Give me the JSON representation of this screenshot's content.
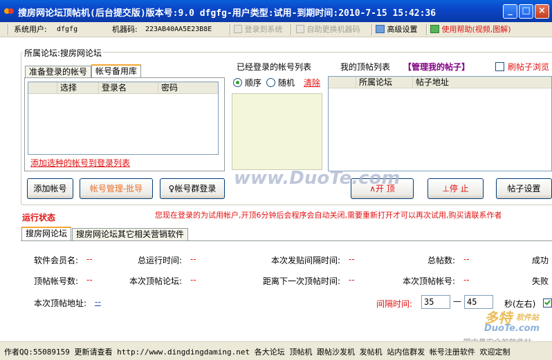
{
  "window": {
    "title": "搜房网论坛顶帖机(后台提交版)版本号:9.0 dfgfg-用户类型:试用-到期时间:2010-7-15 15:42:36",
    "minimize_glyph": "_",
    "maximize_glyph": "□",
    "close_glyph": "×"
  },
  "toolbar": {
    "system_user_label": "系统用户:",
    "system_user_value": "dfgfg",
    "machine_code_label": "机器码:",
    "machine_code_value": "223AB40AA5E23B8E",
    "login_button": "登录到系统",
    "change_machine_button": "自助更换机器码",
    "advanced_settings": "高级设置",
    "help": "使用帮助(视频,图解)"
  },
  "forum_group": {
    "title": "所属论坛:搜房网论坛",
    "tabs": [
      "准备登录的帐号",
      "帐号备用库"
    ],
    "active_tab": 1,
    "columns": [
      "选择",
      "登录名",
      "密码"
    ],
    "add_link": "添加选种的帐号到登录列表"
  },
  "logged_accounts": {
    "title": "已经登录的帐号列表",
    "radio_sequential": "顺序",
    "radio_random": "随机",
    "clear_link": "清除",
    "selected": "顺序"
  },
  "my_posts": {
    "title": "我的顶帖列表",
    "manage_link": "【管理我的帖子】",
    "browse_checkbox": "刷帖子浏览",
    "browse_checked": false,
    "columns": [
      "所属论坛",
      "帖子地址"
    ]
  },
  "buttons": {
    "add_account": "添加帐号",
    "account_manage": "帐号管理-批导",
    "group_login": "♀帐号群登录",
    "start": "∧开  顶",
    "stop": "⊥停  止",
    "post_settings": "帖子设置"
  },
  "notice": "您现在登录的为试用帐户,开顶6分钟后会程序会自动关闭,需要重新打开才可以再次试用,购买请联系作者",
  "run_status": {
    "title": "运行状态",
    "tabs": [
      "搜房网论坛",
      "搜房网论坛其它相关营销软件"
    ],
    "active_tab": 0,
    "stats": {
      "member_name_label": "软件会员名:",
      "member_name_value": "--",
      "total_run_time_label": "总运行时间:",
      "total_run_time_value": "--",
      "post_interval_label": "本次发贴间隔时间:",
      "post_interval_value": "--",
      "total_posts_label": "总帖数:",
      "total_posts_value": "--",
      "success_label": "成功",
      "account_count_label": "顶帖帐号数:",
      "account_count_value": "--",
      "current_forum_label": "本次顶帖论坛:",
      "current_forum_value": "--",
      "next_post_label": "距离下一次顶帖时间:",
      "next_post_value": "--",
      "current_account_label": "本次顶帖帐号:",
      "current_account_value": "--",
      "fail_label": "失败",
      "current_url_label": "本次顶帖地址:",
      "current_url_value": "--"
    },
    "interval_label": "间隔时间:",
    "interval_min": "35",
    "interval_dash": "—",
    "interval_max": "45",
    "interval_unit": "秒(左右)"
  },
  "statusbar": {
    "text": "作者QQ:55089159 更新请查看 http://www.dingdingdaming.net 各大论坛 顶帖机 跟帖沙发机 发帖机 站内信群发 帐号注册软件 欢迎定制"
  },
  "watermarks": {
    "center": "www.DuoTe.com",
    "corner_title": "多特",
    "corner_sub": "软件站",
    "corner_url": "DuoTe.com",
    "corner_bottom": "国内最安全的软件站"
  },
  "colors": {
    "titlebar": "#0a46c8",
    "accent_red": "#e21010",
    "tab_highlight": "#f5a632",
    "link_purple": "#800080"
  }
}
